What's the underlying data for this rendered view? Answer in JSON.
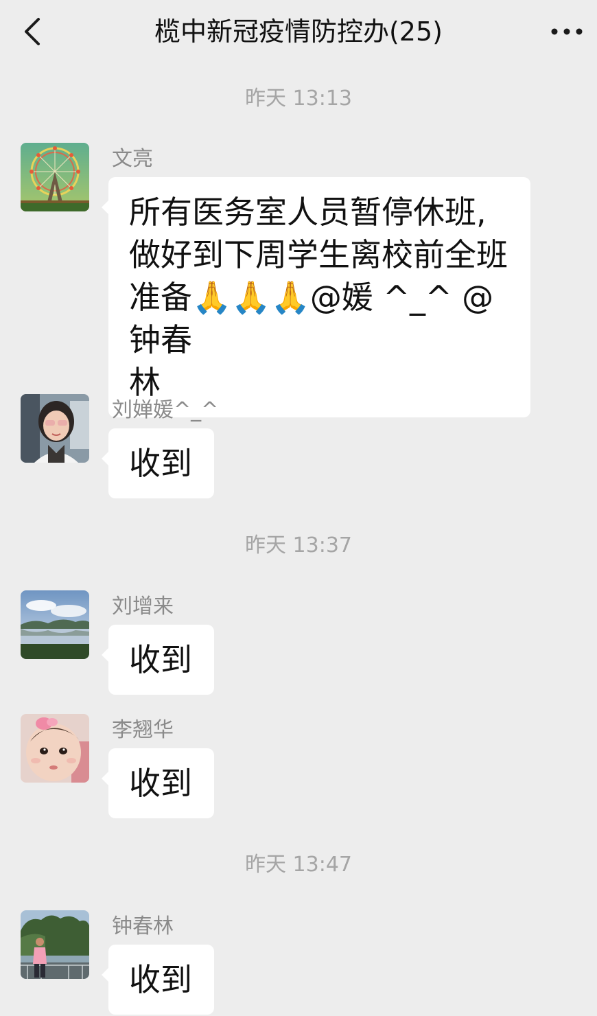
{
  "header": {
    "back_icon": "chevron-left-icon",
    "title": "榄中新冠疫情防控办(25)",
    "more_icon": "more-horizontal-icon"
  },
  "timestamps": [
    "昨天 13:13",
    "昨天 13:37",
    "昨天 13:47"
  ],
  "messages": [
    {
      "sender": "文亮",
      "avatar": "ferris-wheel-photo",
      "text_lines": [
        "所有医务室人员暂停休班,",
        "做好到下周学生离校前全班",
        "准备🙏🙏🙏@媛 ^_^ @钟春",
        "林"
      ]
    },
    {
      "sender": "刘婵媛^_^",
      "avatar": "woman-portrait-photo",
      "text": "收到"
    },
    {
      "sender": "刘增来",
      "avatar": "lake-landscape-photo",
      "text": "收到"
    },
    {
      "sender": "李翘华",
      "avatar": "baby-portrait-photo",
      "text": "收到"
    },
    {
      "sender": "钟春林",
      "avatar": "man-by-river-photo",
      "text": "收到"
    }
  ]
}
